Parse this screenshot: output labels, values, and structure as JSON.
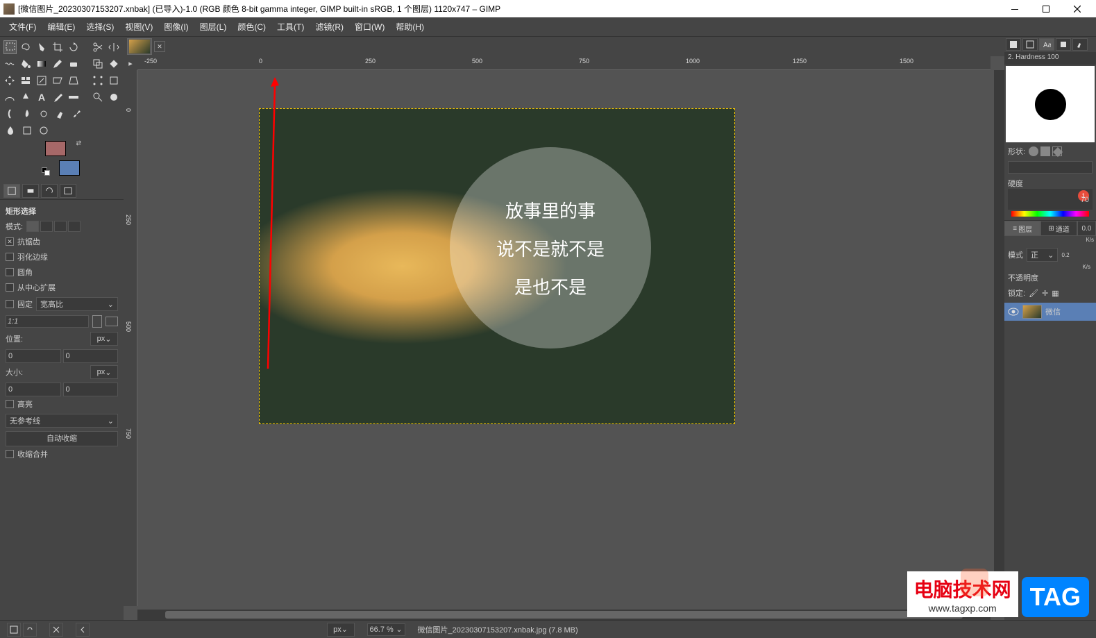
{
  "titlebar": {
    "text": "[微信图片_20230307153207.xnbak] (已导入)-1.0 (RGB 颜色 8-bit gamma integer, GIMP built-in sRGB, 1 个图层) 1120x747 – GIMP"
  },
  "menu": {
    "file": "文件(F)",
    "edit": "编辑(E)",
    "select": "选择(S)",
    "view": "视图(V)",
    "image": "图像(I)",
    "layer": "图层(L)",
    "colors": "颜色(C)",
    "tools": "工具(T)",
    "filters": "滤镜(R)",
    "windows": "窗口(W)",
    "help": "帮助(H)"
  },
  "ruler_h": [
    "-250",
    "0",
    "250",
    "500",
    "750",
    "1000",
    "1250",
    "1500"
  ],
  "ruler_v": [
    "0",
    "250",
    "500",
    "750"
  ],
  "canvas_text": {
    "line1": "放事里的事",
    "line2": "说不是就不是",
    "line3": "是也不是"
  },
  "tool_options": {
    "title": "矩形选择",
    "mode_label": "模式:",
    "antialias": "抗锯齿",
    "feather": "羽化边缘",
    "rounded": "圆角",
    "expand_center": "从中心扩展",
    "fixed": "固定",
    "fixed_value": "宽高比",
    "ratio": "1:1",
    "position": "位置:",
    "position_unit": "px",
    "pos_x": "0",
    "pos_y": "0",
    "size": "大小:",
    "size_unit": "px",
    "size_w": "0",
    "size_h": "0",
    "highlight": "高亮",
    "guides": "无参考线",
    "auto_shrink": "自动收缩",
    "shrink_merged": "收缩合并"
  },
  "right": {
    "brush_name": "2. Hardness 100",
    "shape_label": "形状:",
    "hardness_label": "硬度",
    "warn_badge": "1",
    "percent": "70",
    "layers_tab": "图层",
    "channels_tab": "通道",
    "mode_label": "模式",
    "mode_value": "正",
    "opacity_label": "不透明度",
    "lock_label": "锁定:",
    "layer_name": "微信",
    "extra1": "0.0",
    "extra2": "0.2",
    "kps": "K/s"
  },
  "status": {
    "unit": "px",
    "zoom": "66.7 %",
    "filename": "微信图片_20230307153207.xnbak.jpg (7.8 MB)"
  },
  "watermark": {
    "title": "电脑技术网",
    "url": "www.tagxp.com",
    "tag": "TAG"
  }
}
